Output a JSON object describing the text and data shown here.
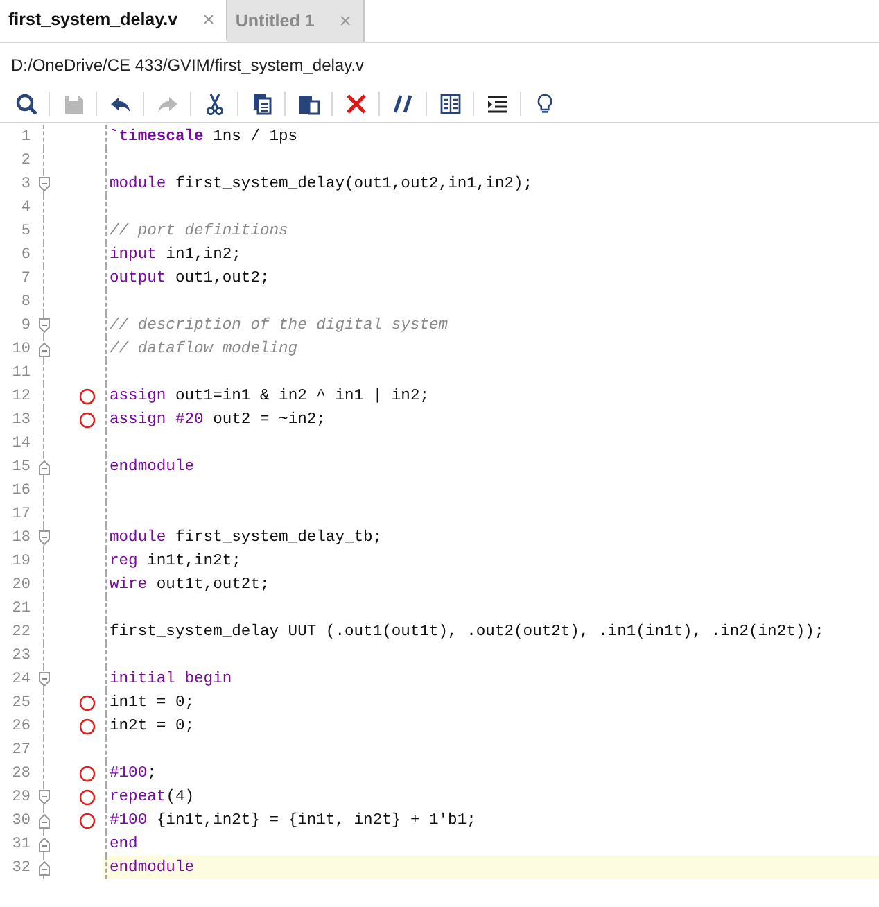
{
  "tabs": [
    {
      "label": "first_system_delay.v",
      "close": "×",
      "selected": true
    },
    {
      "label": "Untitled 1",
      "close": "×",
      "selected": false
    }
  ],
  "path": "D:/OneDrive/CE 433/GVIM/first_system_delay.v",
  "toolbar": [
    {
      "kind": "search",
      "disabled": false
    },
    {
      "kind": "save",
      "disabled": true
    },
    {
      "kind": "undo",
      "disabled": false
    },
    {
      "kind": "redo",
      "disabled": true
    },
    {
      "kind": "cut",
      "disabled": false
    },
    {
      "kind": "copy",
      "disabled": false
    },
    {
      "kind": "paste",
      "disabled": false
    },
    {
      "kind": "delete",
      "disabled": false
    },
    {
      "kind": "comment",
      "disabled": false
    },
    {
      "kind": "columns",
      "disabled": false
    },
    {
      "kind": "indent",
      "disabled": false
    },
    {
      "kind": "bulb",
      "disabled": false
    }
  ],
  "editor": {
    "lines": [
      {
        "number": "1",
        "fold_start": false,
        "fold_end": false,
        "breakpoint": false,
        "current": false,
        "tokens": [
          {
            "kind": "directive",
            "text": "`timescale"
          },
          {
            "kind": "text",
            "text": " 1ns / 1ps"
          }
        ]
      },
      {
        "number": "2",
        "fold_start": false,
        "fold_end": false,
        "breakpoint": false,
        "current": false
      },
      {
        "number": "3",
        "fold_start": true,
        "fold_end": false,
        "breakpoint": false,
        "current": false,
        "tokens": [
          {
            "kind": "keyword",
            "text": "module"
          },
          {
            "kind": "text",
            "text": " first_system_delay(out1,out2,in1,in2);"
          }
        ]
      },
      {
        "number": "4",
        "fold_start": false,
        "fold_end": false,
        "breakpoint": false,
        "current": false
      },
      {
        "number": "5",
        "fold_start": false,
        "fold_end": false,
        "breakpoint": false,
        "current": false,
        "tokens": [
          {
            "kind": "comment",
            "text": "// port definitions"
          }
        ]
      },
      {
        "number": "6",
        "fold_start": false,
        "fold_end": false,
        "breakpoint": false,
        "current": false,
        "tokens": [
          {
            "kind": "keyword",
            "text": "input"
          },
          {
            "kind": "text",
            "text": " in1,in2;"
          }
        ]
      },
      {
        "number": "7",
        "fold_start": false,
        "fold_end": false,
        "breakpoint": false,
        "current": false,
        "tokens": [
          {
            "kind": "keyword",
            "text": "output"
          },
          {
            "kind": "text",
            "text": " out1,out2;"
          }
        ]
      },
      {
        "number": "8",
        "fold_start": false,
        "fold_end": false,
        "breakpoint": false,
        "current": false
      },
      {
        "number": "9",
        "fold_start": true,
        "fold_end": false,
        "breakpoint": false,
        "current": false,
        "tokens": [
          {
            "kind": "comment",
            "text": "// description of the digital system"
          }
        ]
      },
      {
        "number": "10",
        "fold_start": false,
        "fold_end": true,
        "breakpoint": false,
        "current": false,
        "tokens": [
          {
            "kind": "comment",
            "text": "// dataflow modeling"
          }
        ]
      },
      {
        "number": "11",
        "fold_start": false,
        "fold_end": false,
        "breakpoint": false,
        "current": false
      },
      {
        "number": "12",
        "fold_start": false,
        "fold_end": false,
        "breakpoint": true,
        "current": false,
        "tokens": [
          {
            "kind": "keyword",
            "text": "assign"
          },
          {
            "kind": "text",
            "text": " out1=in1 & in2 ^ in1 | in2;"
          }
        ]
      },
      {
        "number": "13",
        "fold_start": false,
        "fold_end": false,
        "breakpoint": true,
        "current": false,
        "tokens": [
          {
            "kind": "keyword",
            "text": "assign"
          },
          {
            "kind": "keyword",
            "text": " #20"
          },
          {
            "kind": "text",
            "text": " out2 = ~in2;"
          }
        ]
      },
      {
        "number": "14",
        "fold_start": false,
        "fold_end": false,
        "breakpoint": false,
        "current": false
      },
      {
        "number": "15",
        "fold_start": false,
        "fold_end": true,
        "breakpoint": false,
        "current": false,
        "tokens": [
          {
            "kind": "keyword",
            "text": "endmodule"
          }
        ]
      },
      {
        "number": "16",
        "fold_start": false,
        "fold_end": false,
        "breakpoint": false,
        "current": false
      },
      {
        "number": "17",
        "fold_start": false,
        "fold_end": false,
        "breakpoint": false,
        "current": false
      },
      {
        "number": "18",
        "fold_start": true,
        "fold_end": false,
        "breakpoint": false,
        "current": false,
        "tokens": [
          {
            "kind": "keyword",
            "text": "module"
          },
          {
            "kind": "text",
            "text": " first_system_delay_tb;"
          }
        ]
      },
      {
        "number": "19",
        "fold_start": false,
        "fold_end": false,
        "breakpoint": false,
        "current": false,
        "tokens": [
          {
            "kind": "keyword",
            "text": "reg"
          },
          {
            "kind": "text",
            "text": " in1t,in2t;"
          }
        ]
      },
      {
        "number": "20",
        "fold_start": false,
        "fold_end": false,
        "breakpoint": false,
        "current": false,
        "tokens": [
          {
            "kind": "keyword",
            "text": "wire"
          },
          {
            "kind": "text",
            "text": " out1t,out2t;"
          }
        ]
      },
      {
        "number": "21",
        "fold_start": false,
        "fold_end": false,
        "breakpoint": false,
        "current": false
      },
      {
        "number": "22",
        "fold_start": false,
        "fold_end": false,
        "breakpoint": false,
        "current": false,
        "tokens": [
          {
            "kind": "text",
            "text": "first_system_delay UUT (.out1(out1t), .out2(out2t), .in1(in1t), .in2(in2t));"
          }
        ]
      },
      {
        "number": "23",
        "fold_start": false,
        "fold_end": false,
        "breakpoint": false,
        "current": false
      },
      {
        "number": "24",
        "fold_start": true,
        "fold_end": false,
        "breakpoint": false,
        "current": false,
        "tokens": [
          {
            "kind": "keyword",
            "text": "initial begin"
          }
        ]
      },
      {
        "number": "25",
        "fold_start": false,
        "fold_end": false,
        "breakpoint": true,
        "current": false,
        "tokens": [
          {
            "kind": "text",
            "text": "in1t = 0;"
          }
        ]
      },
      {
        "number": "26",
        "fold_start": false,
        "fold_end": false,
        "breakpoint": true,
        "current": false,
        "tokens": [
          {
            "kind": "text",
            "text": "in2t = 0;"
          }
        ]
      },
      {
        "number": "27",
        "fold_start": false,
        "fold_end": false,
        "breakpoint": false,
        "current": false
      },
      {
        "number": "28",
        "fold_start": false,
        "fold_end": false,
        "breakpoint": true,
        "current": false,
        "tokens": [
          {
            "kind": "keyword",
            "text": "#100"
          },
          {
            "kind": "text",
            "text": ";"
          }
        ]
      },
      {
        "number": "29",
        "fold_start": true,
        "fold_end": false,
        "breakpoint": true,
        "current": false,
        "tokens": [
          {
            "kind": "keyword",
            "text": "repeat"
          },
          {
            "kind": "text",
            "text": "(4)"
          }
        ]
      },
      {
        "number": "30",
        "fold_start": false,
        "fold_end": true,
        "breakpoint": true,
        "current": false,
        "tokens": [
          {
            "kind": "keyword",
            "text": "#100"
          },
          {
            "kind": "text",
            "text": " {in1t,in2t} = {in1t, in2t} + 1'b1;"
          }
        ]
      },
      {
        "number": "31",
        "fold_start": false,
        "fold_end": true,
        "breakpoint": false,
        "current": false,
        "tokens": [
          {
            "kind": "keyword",
            "text": "end"
          }
        ]
      },
      {
        "number": "32",
        "fold_start": false,
        "fold_end": true,
        "breakpoint": false,
        "current": true,
        "tokens": [
          {
            "kind": "keyword",
            "text": "endmodule"
          }
        ]
      }
    ]
  }
}
